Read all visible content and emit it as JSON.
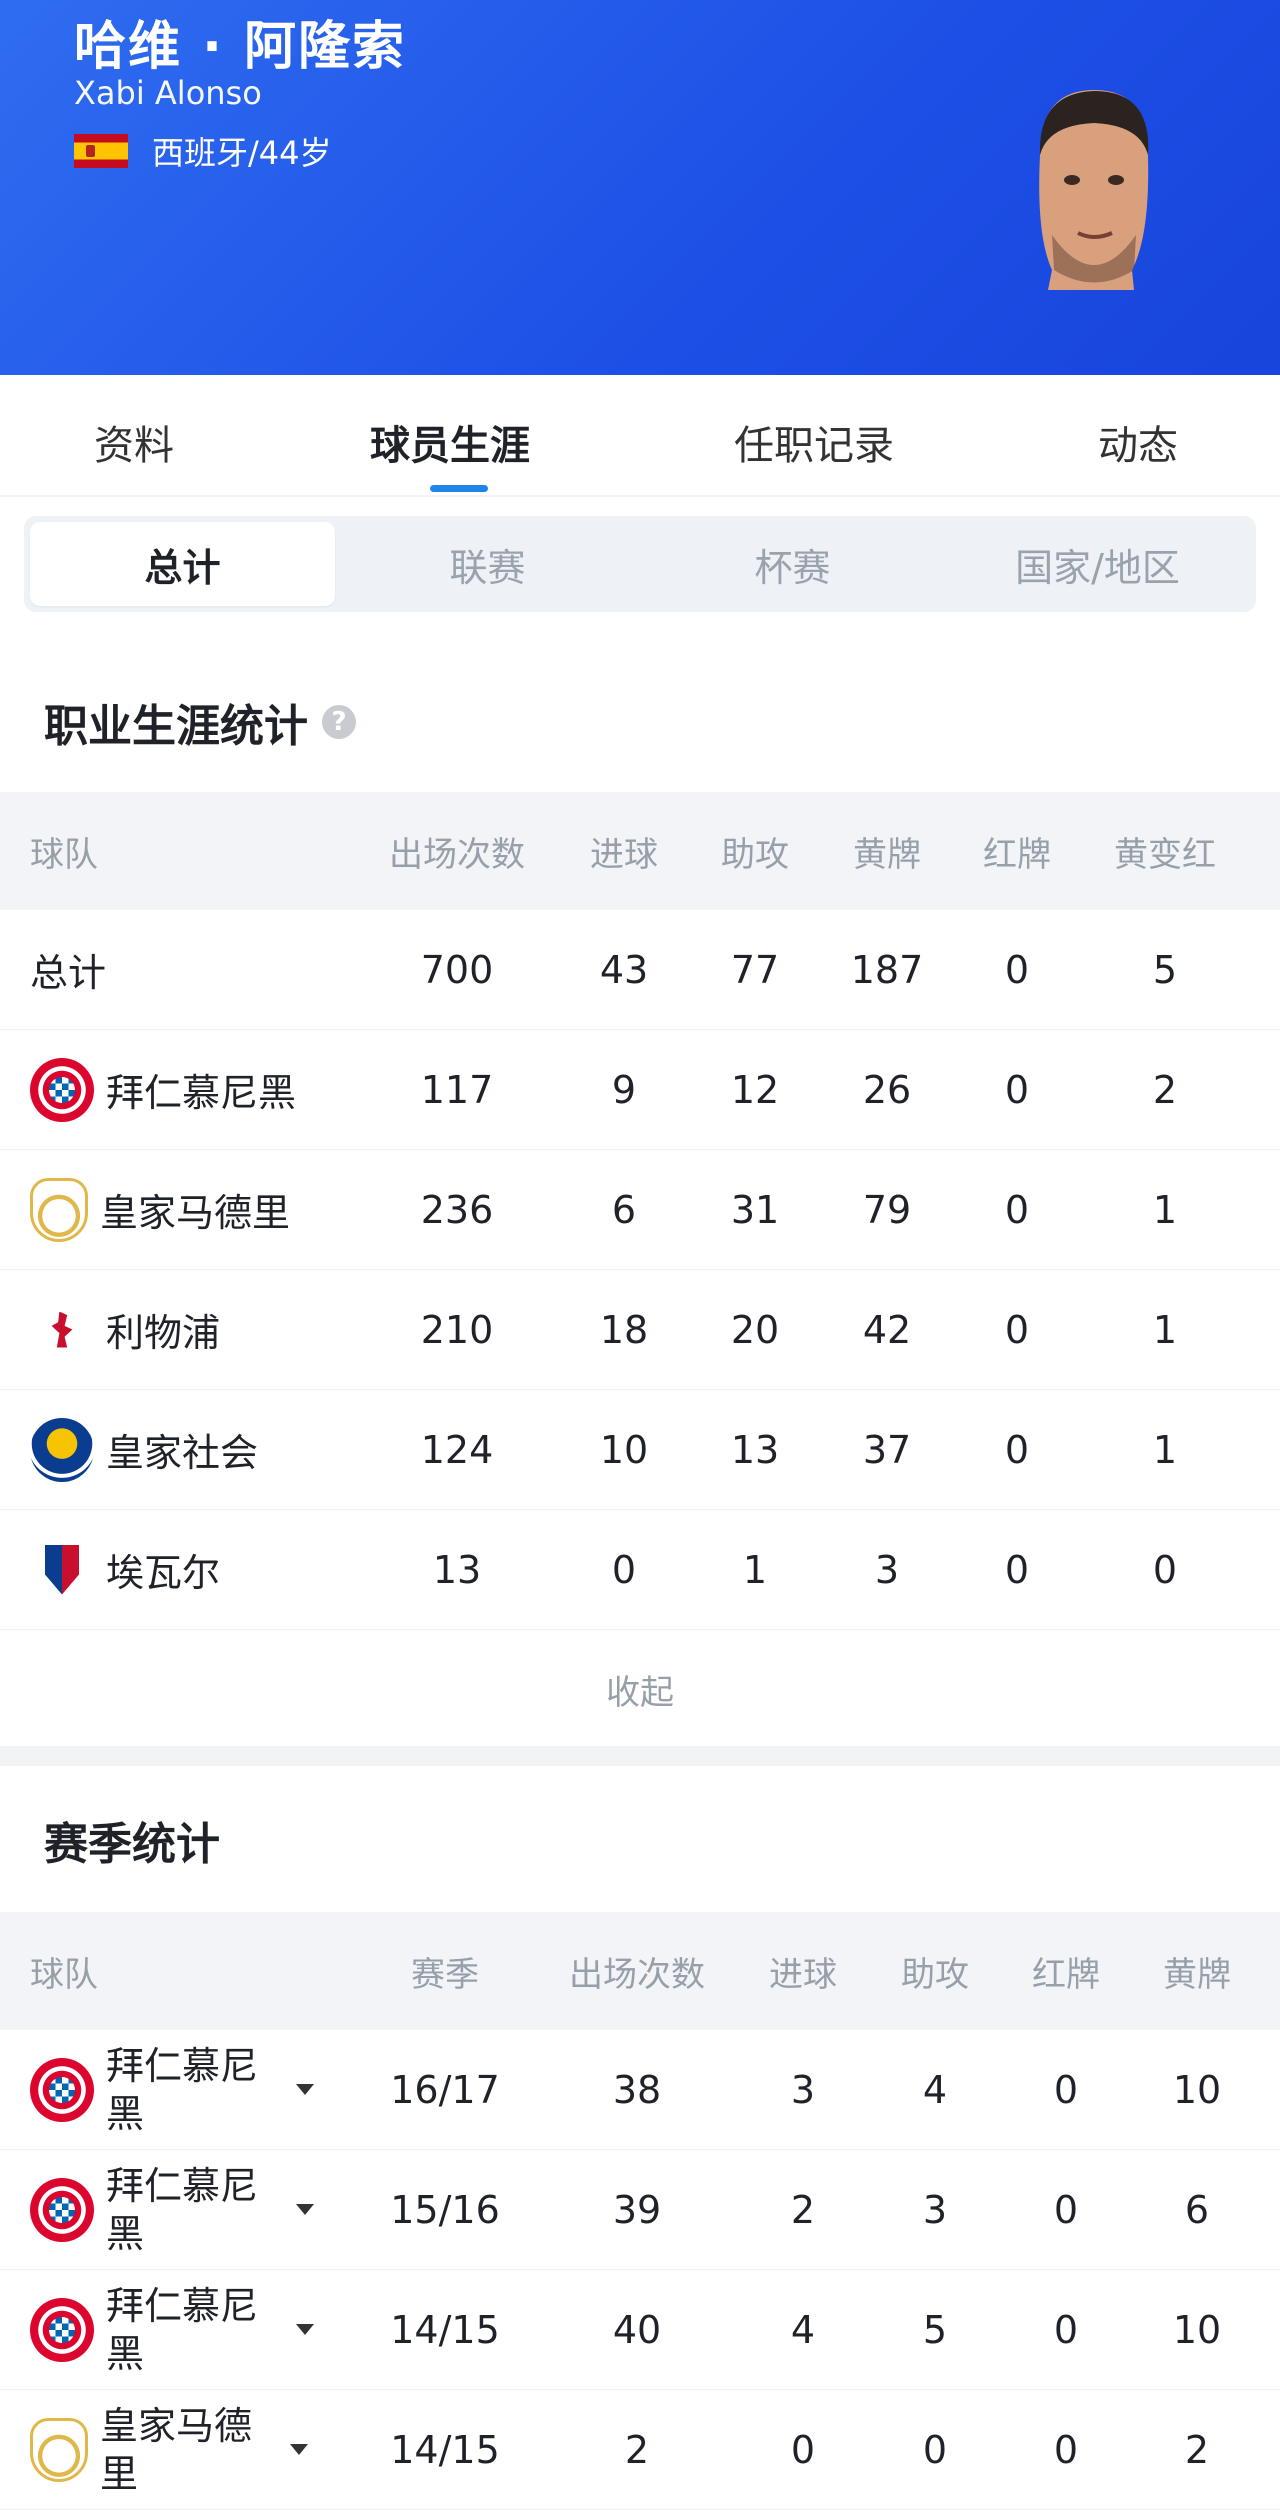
{
  "header": {
    "name_cn": "哈维 · 阿隆索",
    "name_en": "Xabi Alonso",
    "nationality": "西班牙/44岁",
    "flag_icon": "spain-flag-icon",
    "avatar_icon": "player-avatar"
  },
  "tabs": [
    {
      "label": "资料",
      "active": false
    },
    {
      "label": "球员生涯",
      "active": true
    },
    {
      "label": "任职记录",
      "active": false
    },
    {
      "label": "动态",
      "active": false
    }
  ],
  "segments": [
    {
      "label": "总计",
      "active": true
    },
    {
      "label": "联赛",
      "active": false
    },
    {
      "label": "杯赛",
      "active": false
    },
    {
      "label": "国家/地区",
      "active": false
    }
  ],
  "career": {
    "title": "职业生涯统计",
    "help_icon": "?",
    "headers": [
      "球队",
      "出场次数",
      "进球",
      "助攻",
      "黄牌",
      "红牌",
      "黄变红"
    ],
    "rows": [
      {
        "team": "总计",
        "logo": "",
        "cells": [
          "700",
          "43",
          "77",
          "187",
          "0",
          "5"
        ]
      },
      {
        "team": "拜仁慕尼黑",
        "logo": "bayern",
        "cells": [
          "117",
          "9",
          "12",
          "26",
          "0",
          "2"
        ]
      },
      {
        "team": "皇家马德里",
        "logo": "madrid",
        "cells": [
          "236",
          "6",
          "31",
          "79",
          "0",
          "1"
        ]
      },
      {
        "team": "利物浦",
        "logo": "liverpool",
        "cells": [
          "210",
          "18",
          "20",
          "42",
          "0",
          "1"
        ]
      },
      {
        "team": "皇家社会",
        "logo": "sociedad",
        "cells": [
          "124",
          "10",
          "13",
          "37",
          "0",
          "1"
        ]
      },
      {
        "team": "埃瓦尔",
        "logo": "eibar",
        "cells": [
          "13",
          "0",
          "1",
          "3",
          "0",
          "0"
        ]
      }
    ],
    "collapse_label": "收起"
  },
  "season": {
    "title": "赛季统计",
    "headers": [
      "球队",
      "赛季",
      "出场次数",
      "进球",
      "助攻",
      "红牌",
      "黄牌"
    ],
    "rows": [
      {
        "team_line1": "拜仁慕尼",
        "team_line2": "黑",
        "logo": "bayern",
        "cells": [
          "16/17",
          "38",
          "3",
          "4",
          "0",
          "10"
        ]
      },
      {
        "team_line1": "拜仁慕尼",
        "team_line2": "黑",
        "logo": "bayern",
        "cells": [
          "15/16",
          "39",
          "2",
          "3",
          "0",
          "6"
        ]
      },
      {
        "team_line1": "拜仁慕尼",
        "team_line2": "黑",
        "logo": "bayern",
        "cells": [
          "14/15",
          "40",
          "4",
          "5",
          "0",
          "10"
        ]
      },
      {
        "team_line1": "皇家马德",
        "team_line2": "里",
        "logo": "madrid",
        "cells": [
          "14/15",
          "2",
          "0",
          "0",
          "0",
          "2"
        ]
      }
    ]
  }
}
